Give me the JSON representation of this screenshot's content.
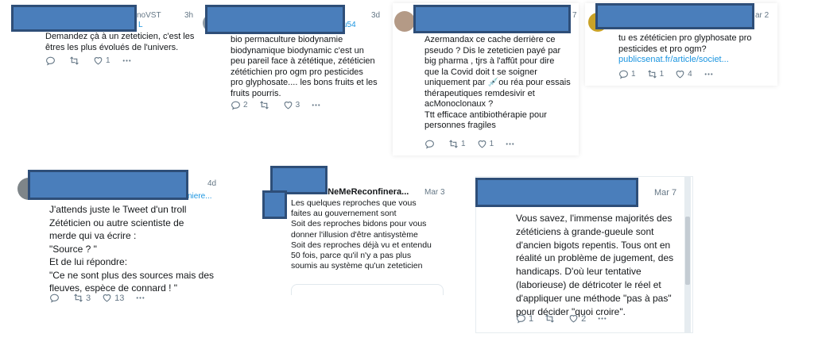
{
  "tweets": [
    {
      "handle_tail": "noVST",
      "handle_line2": "L",
      "time": "3h",
      "body": [
        "Demandez çà à un zeteticien, c'est les",
        "êtres les plus évolués de l'univers."
      ],
      "counts": {
        "reply": "",
        "retweet": "",
        "like": "1"
      }
    },
    {
      "handle_tail": "u54",
      "time": "3d",
      "body": [
        "bio permaculture biodynamie",
        "biodynamique biodynamic c'est un",
        "peu pareil face à zététique, zététicien",
        "zététichien pro ogm pro pesticides",
        "pro glyphosate.... les bons fruits et les",
        "fruits pourris."
      ],
      "counts": {
        "reply": "2",
        "retweet": "",
        "like": "3"
      }
    },
    {
      "time": "7",
      "body": [
        "Azermandax ce  cache derrière ce",
        "pseudo ? Dis le zeteticien payé par",
        "big pharma , tjrs à l'affût pour dire",
        "que la Covid doit t se soigner",
        "uniquement par 💉ou réa pour essais",
        "thérapeutiques remdesivir et",
        "acMonoclonaux ?",
        "Ttt efficace antibiothérapie pour",
        "personnes fragiles"
      ],
      "counts": {
        "reply": "",
        "retweet": "1",
        "like": "1"
      }
    },
    {
      "time": "ar 2",
      "body": [
        "tu es zététicien pro glyphosate pro",
        "pesticides et pro ogm?"
      ],
      "link": "publicsenat.fr/article/societ...",
      "counts": {
        "reply": "1",
        "retweet": "1",
        "like": "4"
      }
    },
    {
      "handle_line2": "niere...",
      "time": "4d",
      "body": [
        "J'attends juste le Tweet d'un troll",
        "Zététicien ou autre scientiste de",
        "merde qui va écrire :",
        "\"Source ? \"",
        "Et de lui répondre:",
        "\"Ce ne sont plus des sources mais des",
        "fleuves, espèce de connard ! \""
      ],
      "counts": {
        "reply": "",
        "retweet": "3",
        "like": "13"
      }
    },
    {
      "handle_tail": "JeNeMeReconfinera...",
      "time": "Mar 3",
      "body": [
        "Les quelques reproches que vous",
        "faites au gouvernement sont",
        "Soit des reproches bidons pour vous",
        "donner l'illusion d'être antisystème",
        "Soit des reproches déjà vu et entendu",
        "50 fois, parce qu'il n'y a pas plus",
        "soumis au système qu'un zeteticien"
      ]
    },
    {
      "time": "Mar 7",
      "body": [
        "Vous savez, l'immense majorités des",
        "zététiciens à grande-gueule sont",
        "d'ancien bigots repentis. Tous ont en",
        "réalité un problème de jugement, des",
        "handicaps. D'où leur tentative",
        "(laborieuse) de détricoter le réel et",
        "d'appliquer une méthode \"pas à pas\"",
        "pour décider \"quoi croire\"."
      ],
      "counts": {
        "reply": "1",
        "retweet": "",
        "like": "2"
      }
    }
  ],
  "icons": {
    "reply": "reply-icon",
    "retweet": "retweet-icon",
    "like": "like-icon",
    "more": "more-icon"
  },
  "colors": {
    "redaction": "#4a7ebb",
    "redaction_border": "#2e4e78",
    "link": "#1b95e0",
    "muted": "#657786"
  }
}
